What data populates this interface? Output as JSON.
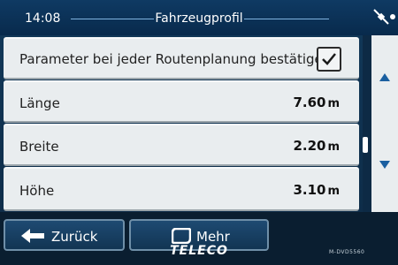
{
  "status_bar": {
    "time": "14:08",
    "title": "Fahrzeugprofil",
    "status_icon": "satellite-icon"
  },
  "settings": [
    {
      "label": "Parameter bei jeder Routenplanung bestätigen",
      "checked": true
    },
    {
      "label": "Länge",
      "value": "7.60",
      "unit": "m"
    },
    {
      "label": "Breite",
      "value": "2.20",
      "unit": "m"
    },
    {
      "label": "Höhe",
      "value": "3.10",
      "unit": "m"
    }
  ],
  "scroll": {
    "up_icon": "arrow-up-icon",
    "down_icon": "arrow-down-icon"
  },
  "toolbar": {
    "back_label": "Zurück",
    "back_icon": "arrow-left-icon",
    "more_label": "Mehr",
    "more_icon": "more-icon"
  },
  "device": {
    "brand": "TELECO",
    "model": "M-DVD5560"
  },
  "colors": {
    "header_bg": "#0f3a63",
    "row_bg": "#e9edef",
    "button_bg": "#1e4a72",
    "accent_line": "#7fb3df"
  }
}
